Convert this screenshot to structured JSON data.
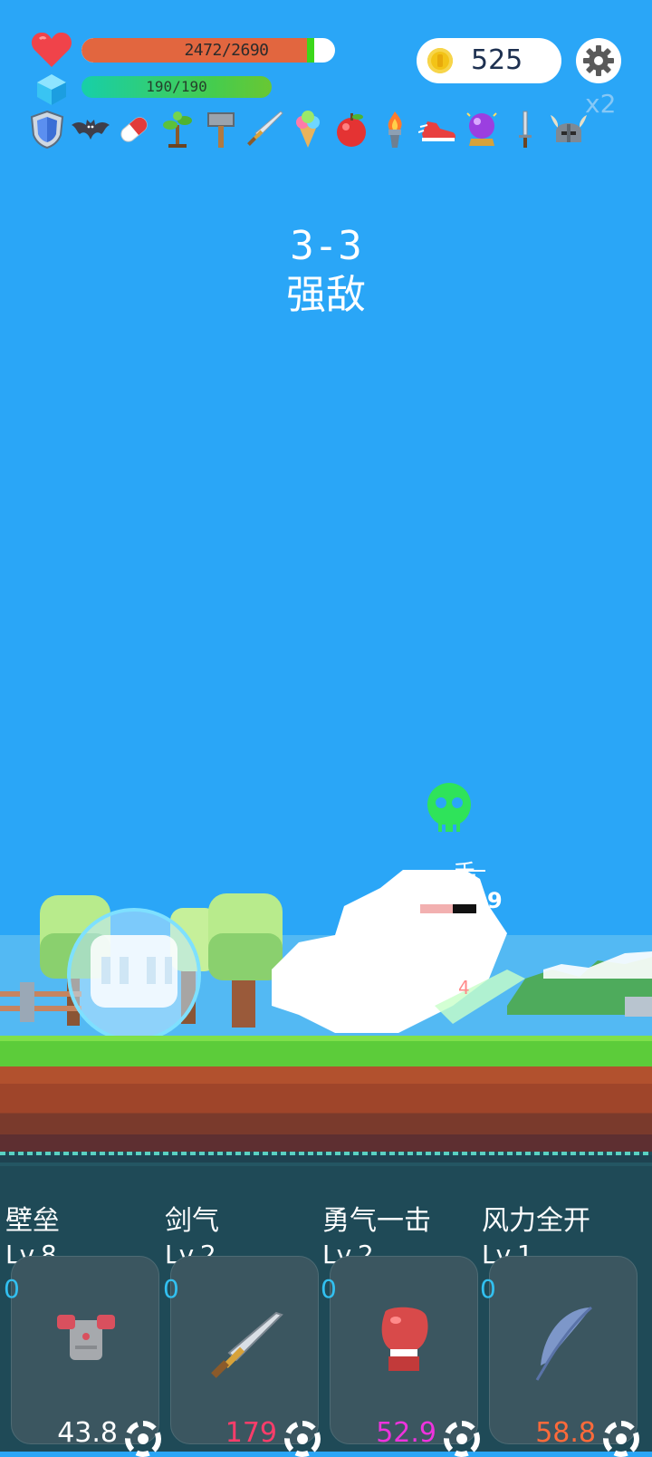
{
  "hud": {
    "hp_text": "2472/2690",
    "hp_fraction": 0.919,
    "mp_text": "190/190",
    "mp_fraction": 1.0,
    "coins": "525",
    "speed": "x2",
    "colors": {
      "hp": "#e2663f",
      "mp": "#46cc4d",
      "sky": "#2aa6f7"
    }
  },
  "items": [
    "shield-icon",
    "bat-icon",
    "pill-icon",
    "sapling-icon",
    "hammer-icon",
    "sword-icon",
    "ice-cream-icon",
    "apple-icon",
    "torch-icon",
    "sneaker-icon",
    "crystal-ball-icon",
    "dagger-icon",
    "viking-helmet-icon"
  ],
  "stage": {
    "number": "3-3",
    "label": "强敌"
  },
  "enemy": {
    "name_fragment": "手",
    "level_fragment": "9",
    "damage_fragment": "4"
  },
  "skills": [
    {
      "name": "壁垒",
      "level": "Lv.8",
      "count": "0",
      "value": "43.8",
      "value_color": "#ffffff",
      "icon": "armor-icon"
    },
    {
      "name": "剑气",
      "level": "Lv.2",
      "count": "0",
      "value": "179",
      "value_color": "#ff3d6a",
      "icon": "sword-icon"
    },
    {
      "name": "勇气一击",
      "level": "Lv.2",
      "count": "0",
      "value": "52.9",
      "value_color": "#ee33dd",
      "icon": "boxing-glove-icon"
    },
    {
      "name": "风力全开",
      "level": "Lv.1",
      "count": "0",
      "value": "58.8",
      "value_color": "#ff6a3a",
      "icon": "feather-icon"
    }
  ]
}
